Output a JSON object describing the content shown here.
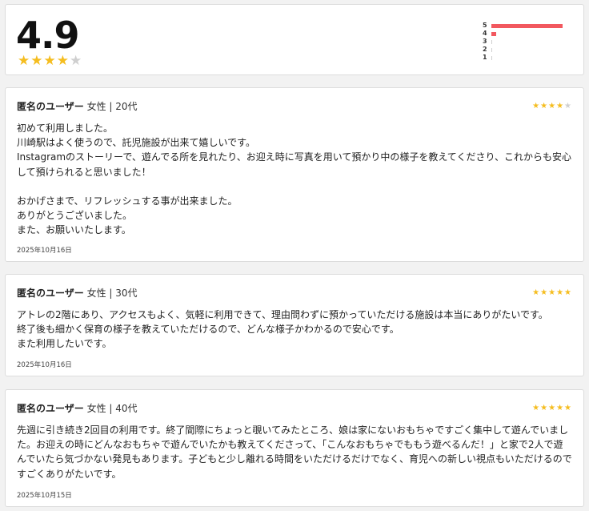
{
  "summary": {
    "average": "4.9",
    "stars_filled": 4,
    "stars_total": 5,
    "histogram": [
      {
        "label": "5",
        "fraction": 1.0
      },
      {
        "label": "4",
        "fraction": 0.07
      },
      {
        "label": "3",
        "fraction": 0.0
      },
      {
        "label": "2",
        "fraction": 0.0
      },
      {
        "label": "1",
        "fraction": 0.0
      }
    ]
  },
  "colors": {
    "star": "#f5bd1f",
    "star_empty": "#cfcfcf",
    "bar": "#f2585f"
  },
  "reviews": [
    {
      "name": "匿名のユーザー",
      "meta": " 女性 | 20代",
      "rating": 4,
      "body": "初めて利用しました。\n川崎駅はよく使うので、託児施設が出来て嬉しいです。\nInstagramのストーリーで、遊んでる所を見れたり、お迎え時に写真を用いて預かり中の様子を教えてくださり、これからも安心して預けられると思いました！\n\nおかげさまで、リフレッシュする事が出来ました。\nありがとうございました。\nまた、お願いいたします。",
      "date": "2025年10月16日"
    },
    {
      "name": "匿名のユーザー",
      "meta": " 女性 | 30代",
      "rating": 5,
      "body": "アトレの2階にあり、アクセスもよく、気軽に利用できて、理由問わずに預かっていただける施設は本当にありがたいです。\n終了後も細かく保育の様子を教えていただけるので、どんな様子かわかるので安心です。\nまた利用したいです。",
      "date": "2025年10月16日"
    },
    {
      "name": "匿名のユーザー",
      "meta": " 女性 | 40代",
      "rating": 5,
      "body": "先週に引き続き2回目の利用です。終了間際にちょっと覗いてみたところ、娘は家にないおもちゃですごく集中して遊んでいました。お迎えの時にどんなおもちゃで遊んでいたかも教えてくださって、「こんなおもちゃでももう遊べるんだ！」と家で2人で遊んでいたら気づかない発見もあります。子どもと少し離れる時間をいただけるだけでなく、育児への新しい視点もいただけるのですごくありがたいです。",
      "date": "2025年10月15日"
    }
  ]
}
